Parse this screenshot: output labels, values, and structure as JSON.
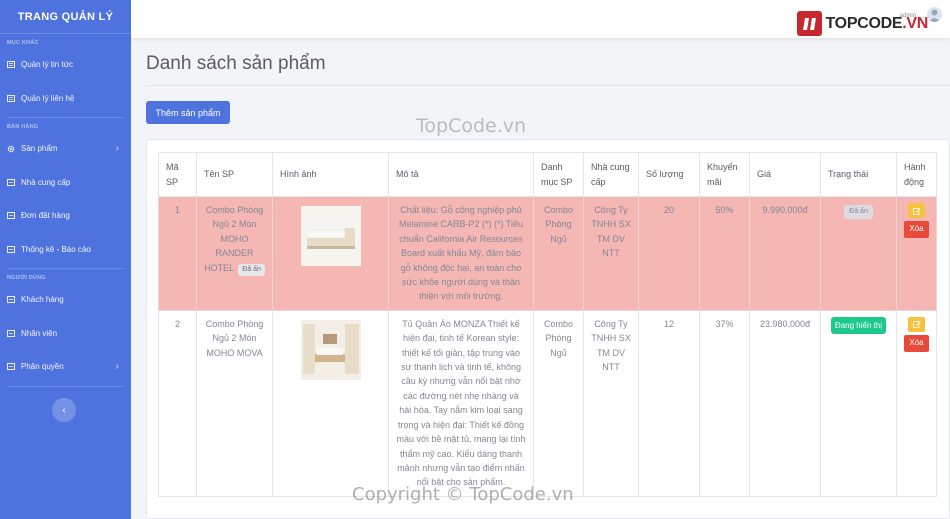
{
  "sidebar": {
    "brand": "TRANG QUẢN LÝ",
    "sections": [
      {
        "heading": "MỤC KHÁC",
        "items": [
          {
            "label": "Quản lý tin tức",
            "icon": "newspaper-icon"
          },
          {
            "label": "Quản lý liên hệ",
            "icon": "contact-icon"
          }
        ]
      },
      {
        "heading": "BÁN HÀNG",
        "items": [
          {
            "label": "Sản phẩm",
            "icon": "gear-icon"
          },
          {
            "label": "Nhà cung cấp",
            "icon": "supplier-icon"
          },
          {
            "label": "Đơn đặt hàng",
            "icon": "order-icon"
          },
          {
            "label": "Thống kê - Báo cáo",
            "icon": "chart-icon"
          }
        ]
      },
      {
        "heading": "NGƯỜI DÙNG",
        "items": [
          {
            "label": "Khách hàng",
            "icon": "customer-icon"
          },
          {
            "label": "Nhân viên",
            "icon": "staff-icon"
          },
          {
            "label": "Phân quyền",
            "icon": "permission-icon"
          }
        ]
      }
    ],
    "toggle_icon": "‹"
  },
  "topbar": {
    "user_name": "admin",
    "logo_text": "TOPCODE",
    "logo_suffix": ".VN"
  },
  "main": {
    "title": "Danh sách sản phẩm",
    "add_button": "Thêm sản phẩm",
    "watermark_top": "TopCode.vn",
    "watermark_bottom": "Copyright © TopCode.vn"
  },
  "table": {
    "headers": [
      "Mã SP",
      "Tên SP",
      "Hình ảnh",
      "Mô tả",
      "Danh mục SP",
      "Nhà cung cấp",
      "Số lượng",
      "Khuyến mãi",
      "Giá",
      "Trạng thái",
      "Hành động"
    ],
    "rows": [
      {
        "id": "1",
        "name": "Combo Phòng Ngủ 2 Món MOHO RANDER HOTEL",
        "name_badge": "Đã ẩn",
        "description": "Chất liệu: Gỗ công nghiệp phủ Melamine CARB-P2 (*) (*) Tiêu chuẩn California Air Resources Board xuất khẩu Mỹ, đảm bảo gỗ không độc hại, an toàn cho sức khỏe người dùng và thân thiện với môi trường.",
        "category": "Combo Phòng Ngủ",
        "supplier": "Công Ty TNHH SX TM DV NTT",
        "quantity": "20",
        "discount": "50%",
        "price": "9.990.000đ",
        "status": "Đã ẩn",
        "edit_icon": "edit-icon",
        "delete_label": "Xóa"
      },
      {
        "id": "2",
        "name": "Combo Phòng Ngủ 2 Món MOHO MOVA",
        "description": "Tủ Quần Áo MONZA Thiết kế hiện đại, tinh tế Korean style: thiết kế tối giản, tập trung vào sự thanh lịch và tinh tế, không cầu kỳ nhưng vẫn nổi bật nhờ các đường nét nhẹ nhàng và hài hòa. Tay nắm kim loại sang trọng và hiện đại: Thiết kế đồng màu với bề mặt tủ, mang lại tính thẩm mỹ cao. Kiểu dáng thanh mảnh nhưng vẫn tạo điểm nhấn nổi bật cho sản phẩm.",
        "category": "Combo Phòng Ngủ",
        "supplier": "Công Ty TNHH SX TM DV NTT",
        "quantity": "12",
        "discount": "37%",
        "price": "23.980.000đ",
        "status": "Đang hiển thị",
        "edit_icon": "edit-icon",
        "delete_label": "Xóa"
      }
    ]
  },
  "colors": {
    "sidebar": "#4e73df",
    "highlight_row": "#f4b7b4",
    "success": "#1cc88a",
    "warning": "#f6c23e",
    "danger": "#e74a3b"
  }
}
